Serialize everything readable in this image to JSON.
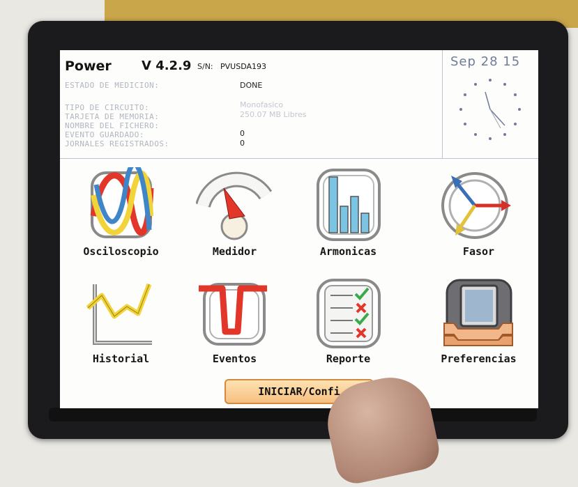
{
  "status": {
    "brand": "Power",
    "version": "V 4.2.9",
    "sn_label": "S/N:",
    "sn_value": "PVUSDA193",
    "date": "Sep 28 15",
    "rows": [
      {
        "label": "ESTADO DE MEDICION:",
        "value": "DONE"
      },
      {
        "label": "TIPO DE CIRCUITO:",
        "value": "Monofasico"
      },
      {
        "label": "TARJETA DE MEMORIA:",
        "value": "250.07 MB Libres"
      },
      {
        "label": "NOMBRE DEL FICHERO:",
        "value": ""
      },
      {
        "label": "EVENTO GUARDADO:",
        "value": "0"
      },
      {
        "label": "JORNALES REGISTRADOS:",
        "value": "0"
      }
    ]
  },
  "tiles": [
    {
      "label": "Osciloscopio",
      "icon": "oscilloscope-icon"
    },
    {
      "label": "Medidor",
      "icon": "meter-gauge-icon"
    },
    {
      "label": "Armonicas",
      "icon": "harmonics-bars-icon"
    },
    {
      "label": "Fasor",
      "icon": "phasor-arrows-icon"
    },
    {
      "label": "Historial",
      "icon": "history-chart-icon"
    },
    {
      "label": "Eventos",
      "icon": "events-waveform-icon"
    },
    {
      "label": "Reporte",
      "icon": "report-checklist-icon"
    },
    {
      "label": "Preferencias",
      "icon": "preferences-tool-icon"
    }
  ],
  "start_button": {
    "label": "INICIAR/Confi"
  },
  "colors": {
    "screen": "#fdfdfb",
    "bezel": "#1b1b1d",
    "button_fill": "#f6bf80",
    "button_border": "#d48a3c",
    "status_label": "#b0b5c1",
    "date_text": "#6f7b97"
  }
}
